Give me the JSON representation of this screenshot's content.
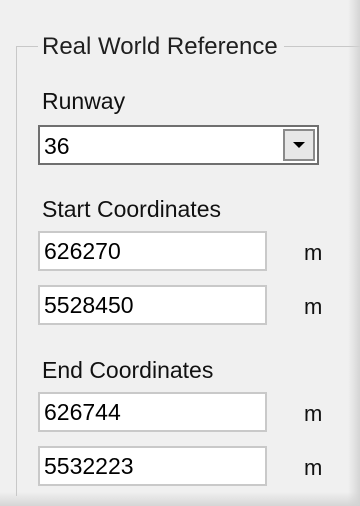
{
  "group": {
    "title": "Real World Reference"
  },
  "runway": {
    "label": "Runway",
    "selected": "36"
  },
  "start": {
    "label": "Start Coordinates",
    "x": "626270",
    "y": "5528450",
    "unit": "m"
  },
  "end": {
    "label": "End Coordinates",
    "x": "626744",
    "y": "5532223",
    "unit": "m"
  },
  "icons": {
    "dropdown": "chevron-down-icon"
  }
}
